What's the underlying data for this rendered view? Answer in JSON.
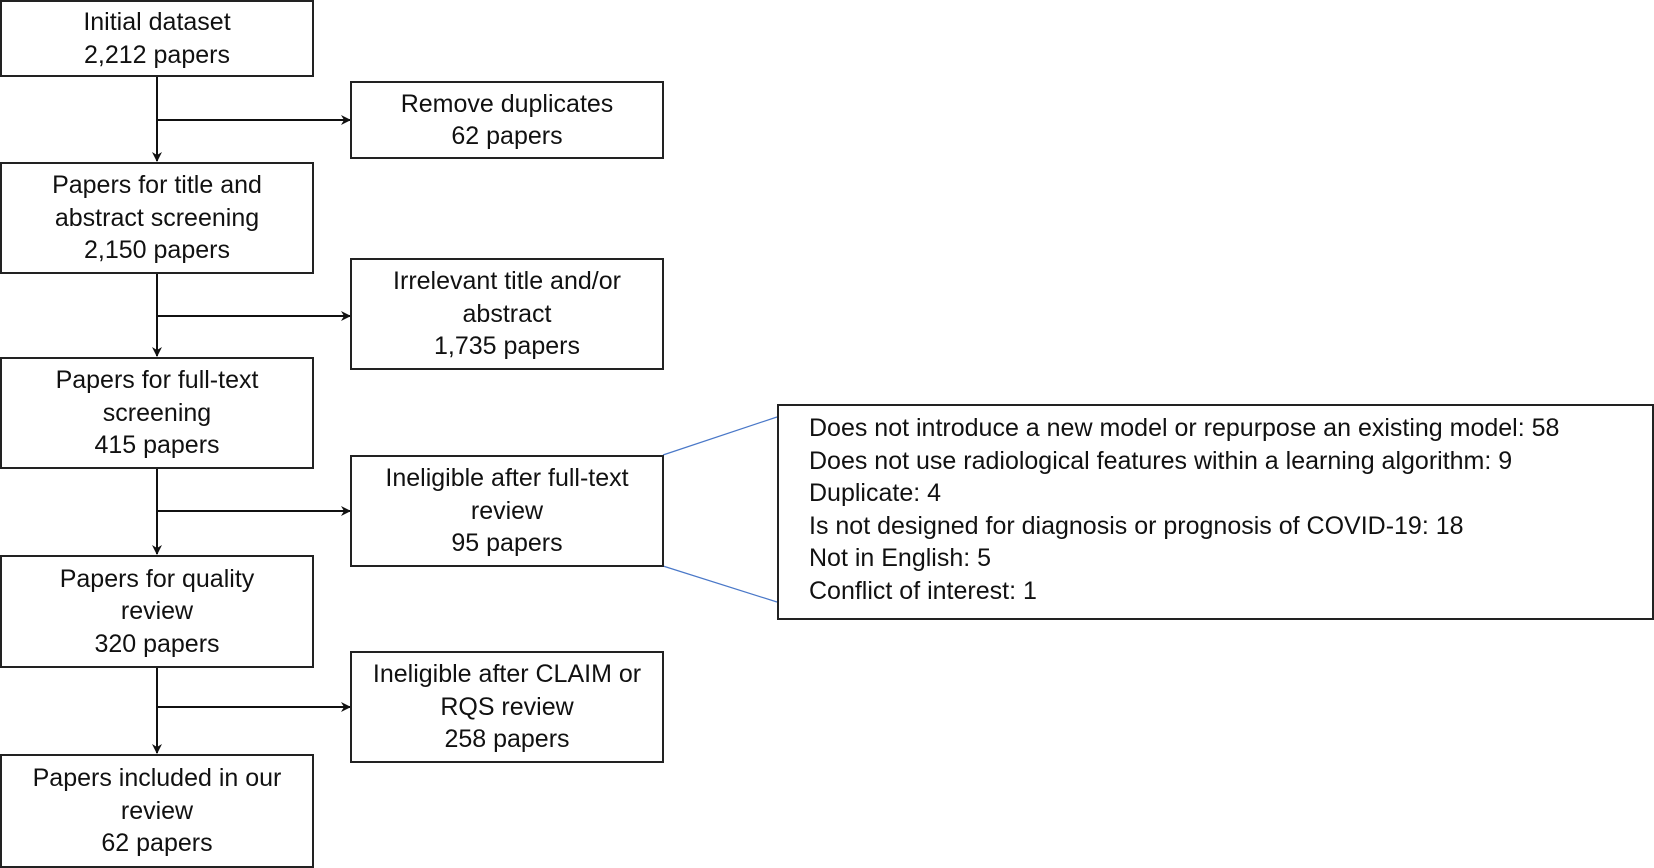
{
  "flow": {
    "main": [
      {
        "lines": [
          "Initial dataset",
          "2,212 papers"
        ]
      },
      {
        "lines": [
          "Papers for title and",
          "abstract screening",
          "2,150 papers"
        ]
      },
      {
        "lines": [
          "Papers for full-text",
          "screening",
          "415 papers"
        ]
      },
      {
        "lines": [
          "Papers for quality",
          "review",
          "320 papers"
        ]
      },
      {
        "lines": [
          "Papers included in our",
          "review",
          "62 papers"
        ]
      }
    ],
    "excluded": [
      {
        "lines": [
          "Remove duplicates",
          "62 papers"
        ]
      },
      {
        "lines": [
          "Irrelevant title and/or",
          "abstract",
          "1,735 papers"
        ]
      },
      {
        "lines": [
          "Ineligible after full-text",
          "review",
          "95 papers"
        ]
      },
      {
        "lines": [
          "Ineligible after CLAIM or",
          "RQS review",
          "258 papers"
        ]
      }
    ],
    "detail": {
      "items": [
        "Does not introduce a new model or repurpose an existing model: 58",
        "Does not use radiological features within a learning algorithm: 9",
        "Duplicate: 4",
        "Is not designed for diagnosis or prognosis of COVID-19: 18",
        "Not in English: 5",
        "Conflict of interest: 1"
      ]
    }
  },
  "colors": {
    "box_border": "#222222",
    "arrow": "#111111",
    "callout_line": "#4a78c8"
  }
}
